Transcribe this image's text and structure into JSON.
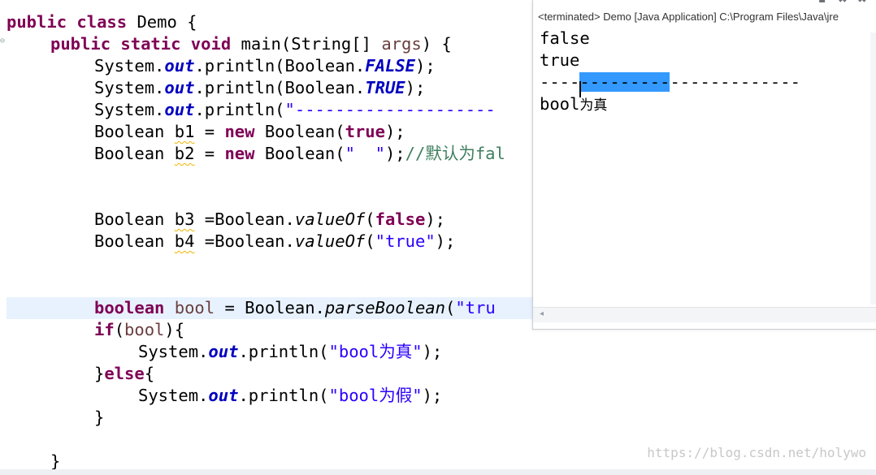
{
  "editor": {
    "lines": {
      "l1_kw": "public class",
      "l1_name": " Demo {",
      "l2_kw": "public static void",
      "l2_main": " main(String[] ",
      "l2_param": "args",
      "l2_end": ") {",
      "l3_a": "System.",
      "l3_out": "out",
      "l3_b": ".println(Boolean.",
      "l3_const": "FALSE",
      "l3_c": ");",
      "l4_a": "System.",
      "l4_out": "out",
      "l4_b": ".println(Boolean.",
      "l4_const": "TRUE",
      "l4_c": ");",
      "l5_a": "System.",
      "l5_out": "out",
      "l5_b": ".println(",
      "l5_str": "\"--------------------",
      "l6_a": "Boolean ",
      "l6_var": "b1",
      "l6_b": " = ",
      "l6_new": "new",
      "l6_c": " Boolean(",
      "l6_true": "true",
      "l6_d": ");",
      "l7_a": "Boolean ",
      "l7_var": "b2",
      "l7_b": " = ",
      "l7_new": "new",
      "l7_c": " Boolean(",
      "l7_str": "\"  \"",
      "l7_d": ");",
      "l7_cmt": "//默认为fal",
      "l8_a": "Boolean ",
      "l8_var": "b3",
      "l8_b": " =Boolean.",
      "l8_m": "valueOf",
      "l8_c": "(",
      "l8_false": "false",
      "l8_d": ");",
      "l9_a": "Boolean ",
      "l9_var": "b4",
      "l9_b": " =Boolean.",
      "l9_m": "valueOf",
      "l9_c": "(",
      "l9_str": "\"true\"",
      "l9_d": ");",
      "l10_kw": "boolean",
      "l10_var": " bool",
      "l10_b": " = Boolean.",
      "l10_m": "parseBoolean",
      "l10_c": "(",
      "l10_str": "\"tru",
      "l11_kw": "if",
      "l11_b": "(",
      "l11_var": "bool",
      "l11_c": "){",
      "l12_a": "System.",
      "l12_out": "out",
      "l12_b": ".println(",
      "l12_str": "\"bool为真\"",
      "l12_c": ");",
      "l13_a": "}",
      "l13_kw": "else",
      "l13_b": "{",
      "l14_a": "System.",
      "l14_out": "out",
      "l14_b": ".println(",
      "l14_str": "\"bool为假\"",
      "l14_c": ");",
      "l15": "}",
      "l16": "}"
    }
  },
  "console": {
    "header": "<terminated> Demo [Java Application] C:\\Program Files\\Java\\jre",
    "output": {
      "line1": "false",
      "line2": "true",
      "line3_pre": "----",
      "line3_sel": "---------",
      "line3_post": "-------------",
      "line4_a": "bool",
      "line4_b": "为真"
    },
    "toolbar_icons": [
      "remove-launch-icon",
      "remove-all-terminated-icon",
      "pin-console-icon"
    ]
  },
  "watermark": "https://blog.csdn.net/holywo",
  "colors": {
    "keyword": "#7f0055",
    "field": "#0000c0",
    "string": "#2a00ff",
    "comment": "#3f7f5f",
    "selection": "#3399ff",
    "current_line": "#e8f2fe"
  }
}
